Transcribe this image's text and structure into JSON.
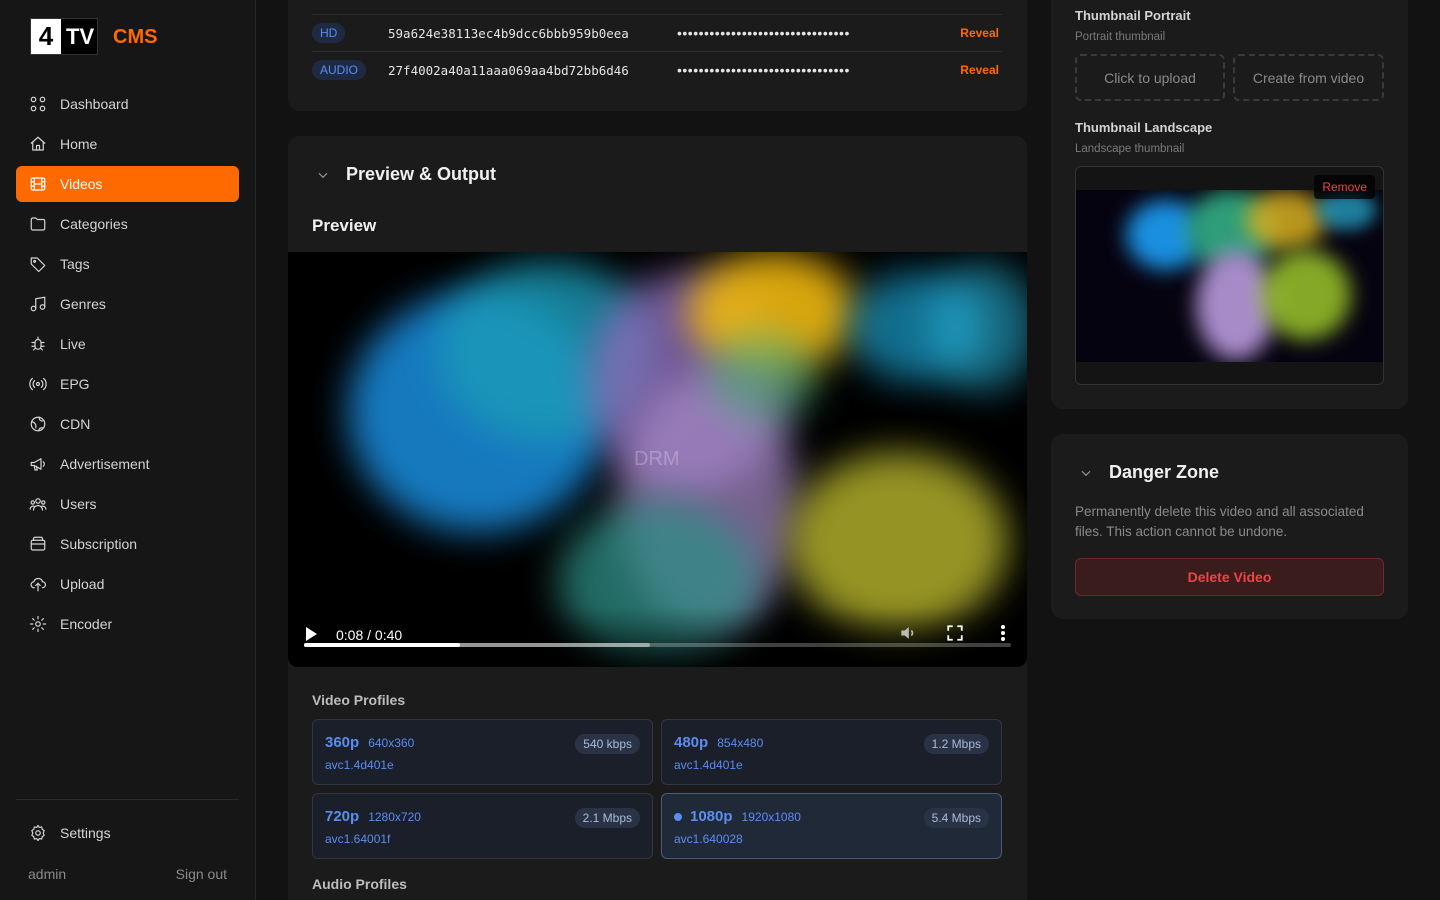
{
  "brand": {
    "logo_num": "4",
    "logo_tv": "TV",
    "logo_cms": "CMS"
  },
  "sidebar": {
    "items": [
      {
        "label": "Dashboard",
        "icon": "grid-icon"
      },
      {
        "label": "Home",
        "icon": "home-icon"
      },
      {
        "label": "Videos",
        "icon": "film-icon",
        "active": true
      },
      {
        "label": "Categories",
        "icon": "folder-icon"
      },
      {
        "label": "Tags",
        "icon": "tag-icon"
      },
      {
        "label": "Genres",
        "icon": "music-icon"
      },
      {
        "label": "Live",
        "icon": "bug-icon"
      },
      {
        "label": "EPG",
        "icon": "broadcast-icon"
      },
      {
        "label": "CDN",
        "icon": "globe-icon"
      },
      {
        "label": "Advertisement",
        "icon": "megaphone-icon"
      },
      {
        "label": "Users",
        "icon": "users-icon"
      },
      {
        "label": "Subscription",
        "icon": "wallet-icon"
      },
      {
        "label": "Upload",
        "icon": "cloud-upload-icon"
      },
      {
        "label": "Encoder",
        "icon": "cog-icon"
      }
    ],
    "settings_label": "Settings",
    "user": "admin",
    "sign_out": "Sign out"
  },
  "drm_keys": {
    "rows": [
      {
        "label": "HD",
        "kid": "59a624e38113ec4b9dcc6bbb959b0eea",
        "key_mask": "••••••••••••••••••••••••••••••••",
        "action": "Reveal"
      },
      {
        "label": "AUDIO",
        "kid": "27f4002a40a11aaa069aa4bd72bb6d46",
        "key_mask": "••••••••••••••••••••••••••••••••",
        "action": "Reveal"
      }
    ]
  },
  "preview_output": {
    "title": "Preview & Output",
    "preview_label": "Preview",
    "watermark": "DRM",
    "player": {
      "time": "0:08 / 0:40",
      "played_fraction": 0.22,
      "buffered_fraction": 0.49
    },
    "video_profiles_label": "Video Profiles",
    "video_profiles": [
      {
        "res": "360p",
        "dim": "640x360",
        "codec": "avc1.4d401e",
        "rate": "540 kbps",
        "selected": false
      },
      {
        "res": "480p",
        "dim": "854x480",
        "codec": "avc1.4d401e",
        "rate": "1.2 Mbps",
        "selected": false
      },
      {
        "res": "720p",
        "dim": "1280x720",
        "codec": "avc1.64001f",
        "rate": "2.1 Mbps",
        "selected": false
      },
      {
        "res": "1080p",
        "dim": "1920x1080",
        "codec": "avc1.640028",
        "rate": "5.4 Mbps",
        "selected": true
      }
    ],
    "audio_profiles_label": "Audio Profiles"
  },
  "thumbnails": {
    "portrait_title": "Thumbnail Portrait",
    "portrait_hint": "Portrait thumbnail",
    "upload_label": "Click to upload",
    "create_label": "Create from video",
    "landscape_title": "Thumbnail Landscape",
    "landscape_hint": "Landscape thumbnail",
    "remove_label": "Remove"
  },
  "danger": {
    "title": "Danger Zone",
    "text": "Permanently delete this video and all associated files. This action cannot be undone.",
    "button": "Delete Video"
  },
  "colors": {
    "accent": "#ff6a00",
    "profile_blue": "#5b8def",
    "danger": "#ef4444"
  }
}
